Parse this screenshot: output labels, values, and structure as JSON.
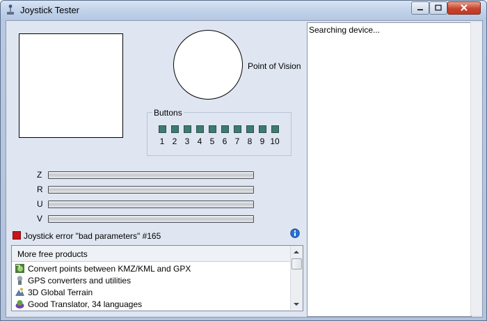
{
  "window": {
    "title": "Joystick Tester"
  },
  "pov": {
    "label": "Point of Vision"
  },
  "buttons": {
    "legend": "Buttons",
    "numbers": [
      "1",
      "2",
      "3",
      "4",
      "5",
      "6",
      "7",
      "8",
      "9",
      "10"
    ],
    "led_color": "#3d7a73"
  },
  "axes": [
    {
      "label": "Z"
    },
    {
      "label": "R"
    },
    {
      "label": "U"
    },
    {
      "label": "V"
    }
  ],
  "status": {
    "text": "Joystick error \"bad parameters\" #165",
    "color": "#c9141b"
  },
  "products": {
    "header": "More free products",
    "items": [
      {
        "icon": "convert-globe-icon",
        "label": "Convert points between KMZ/KML and GPX"
      },
      {
        "icon": "gps-icon",
        "label": "GPS converters and utilities"
      },
      {
        "icon": "terrain-icon",
        "label": "3D Global Terrain"
      },
      {
        "icon": "translator-icon",
        "label": "Good Translator, 34 languages"
      }
    ]
  },
  "log": {
    "text": "Searching device..."
  }
}
